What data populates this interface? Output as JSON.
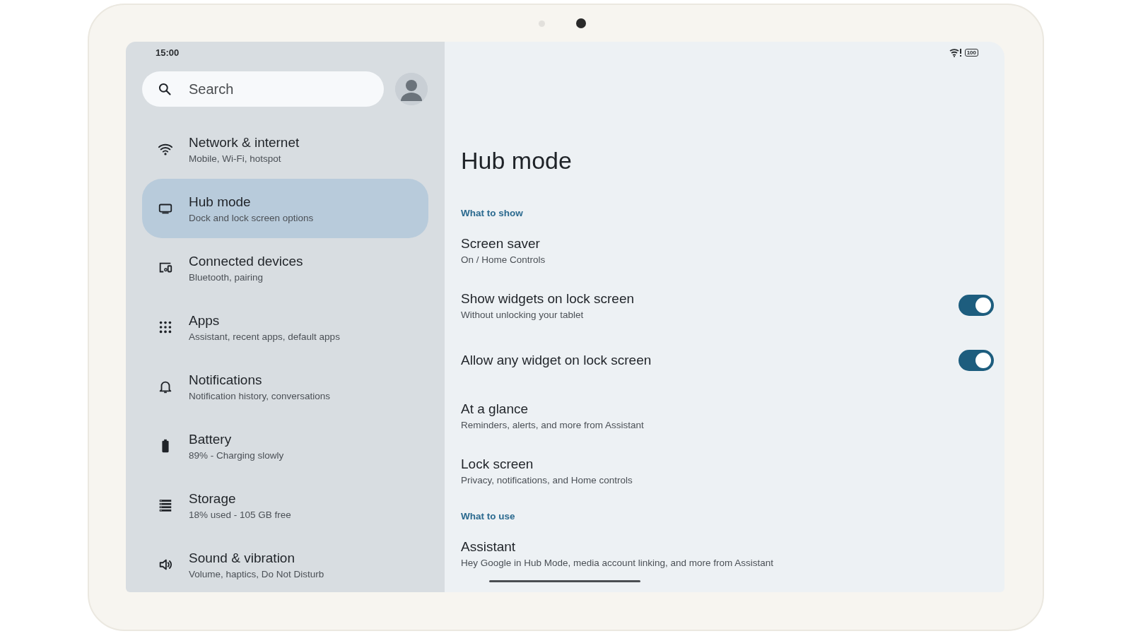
{
  "status_bar": {
    "time": "15:00",
    "battery": "100"
  },
  "search": {
    "placeholder": "Search"
  },
  "sidebar": {
    "items": [
      {
        "title": "Network & internet",
        "subtitle": "Mobile, Wi-Fi, hotspot",
        "selected": false
      },
      {
        "title": "Hub mode",
        "subtitle": "Dock and lock screen options",
        "selected": true
      },
      {
        "title": "Connected devices",
        "subtitle": "Bluetooth, pairing",
        "selected": false
      },
      {
        "title": "Apps",
        "subtitle": "Assistant, recent apps, default apps",
        "selected": false
      },
      {
        "title": "Notifications",
        "subtitle": "Notification history, conversations",
        "selected": false
      },
      {
        "title": "Battery",
        "subtitle": "89% - Charging slowly",
        "selected": false
      },
      {
        "title": "Storage",
        "subtitle": "18% used - 105 GB free",
        "selected": false
      },
      {
        "title": "Sound & vibration",
        "subtitle": "Volume, haptics, Do Not Disturb",
        "selected": false
      }
    ]
  },
  "page": {
    "title": "Hub mode",
    "sections": [
      {
        "header": "What to show",
        "items": [
          {
            "kind": "link",
            "title": "Screen saver",
            "subtitle": "On / Home Controls"
          },
          {
            "kind": "toggle",
            "title": "Show widgets on lock screen",
            "subtitle": "Without unlocking your tablet",
            "on": true
          },
          {
            "kind": "toggle",
            "title": "Allow any widget on lock screen",
            "on": true
          },
          {
            "kind": "link",
            "title": "At a glance",
            "subtitle": "Reminders, alerts, and more from Assistant"
          },
          {
            "kind": "link",
            "title": "Lock screen",
            "subtitle": "Privacy, notifications, and Home controls"
          }
        ]
      },
      {
        "header": "What to use",
        "items": [
          {
            "kind": "link",
            "title": "Assistant",
            "subtitle": "Hey Google in Hub Mode, media account linking, and more from Assistant"
          }
        ]
      }
    ]
  }
}
